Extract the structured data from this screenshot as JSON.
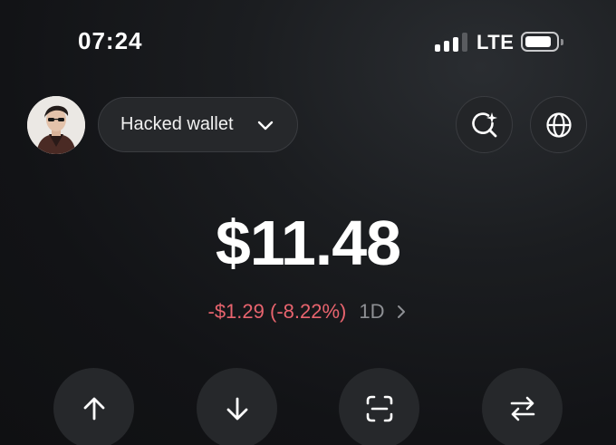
{
  "status_bar": {
    "time": "07:24",
    "network": "LTE"
  },
  "header": {
    "wallet_name": "Hacked wallet",
    "avatar_icon": "avatar-illustration",
    "search_icon": "search-sparkle-icon",
    "globe_icon": "globe-icon"
  },
  "balance": {
    "amount": "$11.48",
    "change": "-$1.29 (-8.22%)",
    "period": "1D"
  },
  "actions": [
    {
      "icon": "arrow-up-icon"
    },
    {
      "icon": "arrow-down-icon"
    },
    {
      "icon": "scan-icon"
    },
    {
      "icon": "swap-icon"
    }
  ],
  "colors": {
    "background": "#121316",
    "surface": "#26282b",
    "negative": "#e8646e",
    "muted": "#8e9094"
  }
}
